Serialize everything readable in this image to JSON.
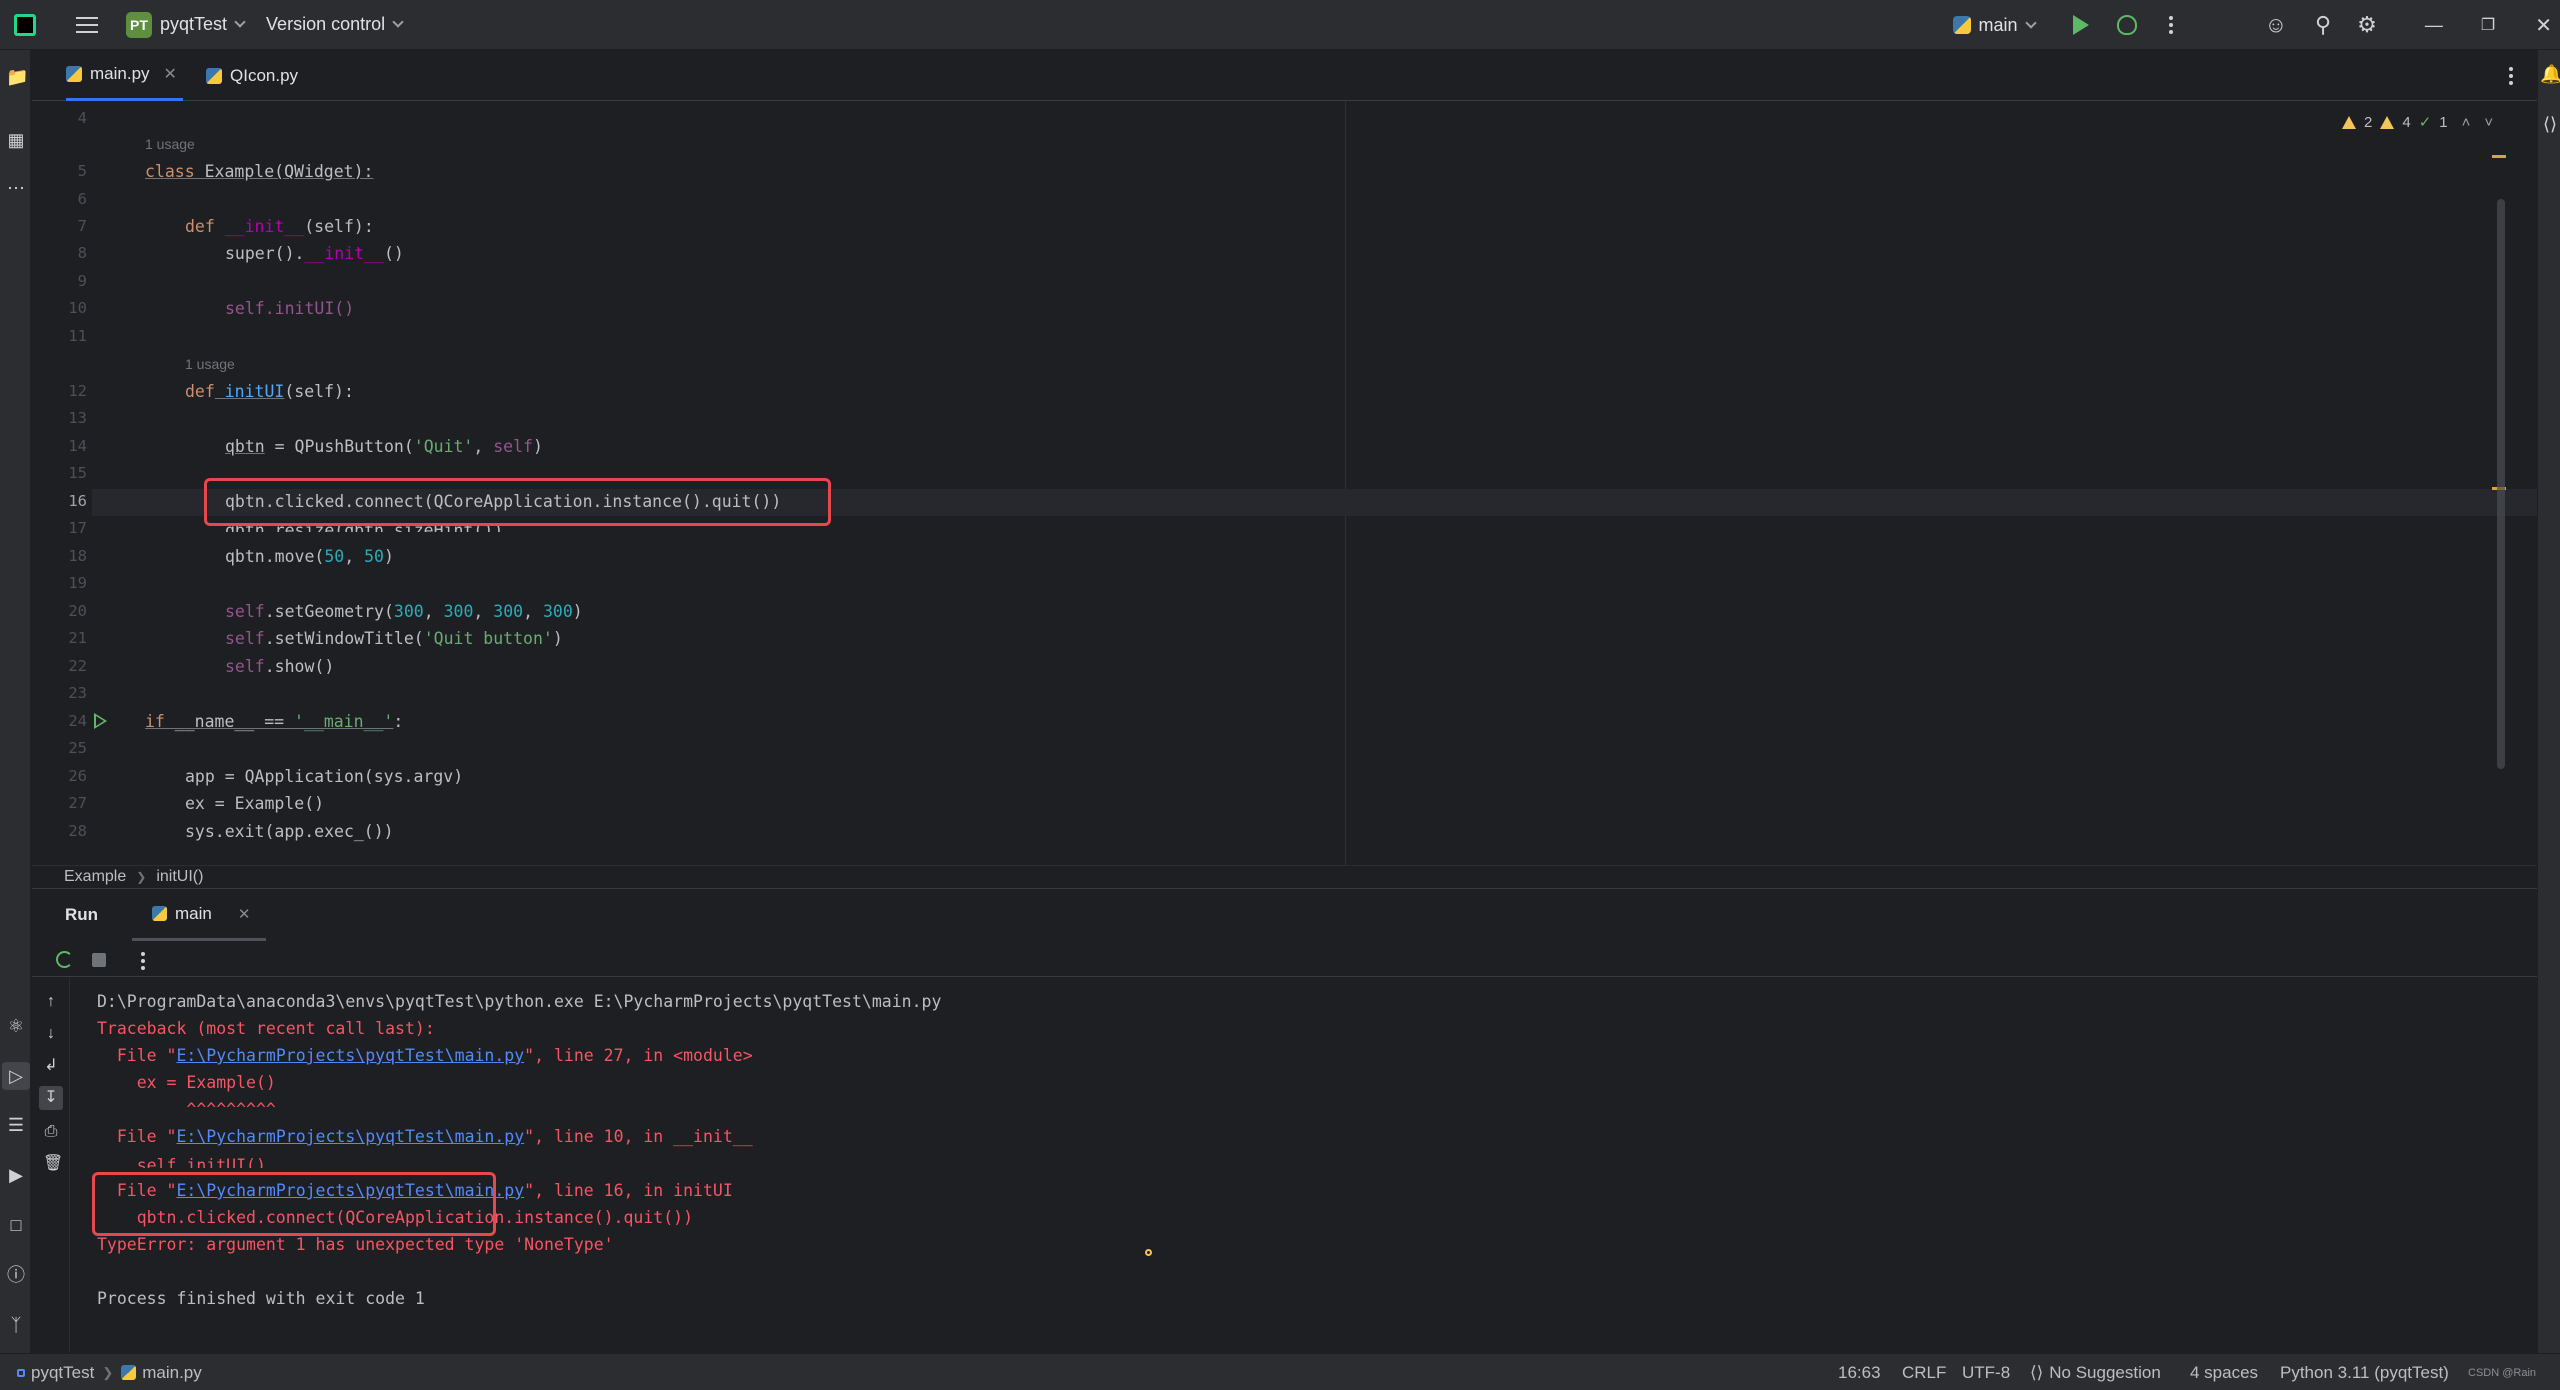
{
  "titlebar": {
    "project_badge": "PT",
    "project_name": "pyqtTest",
    "vcs_menu": "Version control",
    "run_config": "main"
  },
  "tabs": [
    {
      "label": "main.py",
      "active": true
    },
    {
      "label": "QIcon.py",
      "active": false
    }
  ],
  "inspections": {
    "warnings_a": "2",
    "warnings_b": "4",
    "ok": "1"
  },
  "editor": {
    "usage_hint": "1 usage",
    "current_line": 16,
    "lines": [
      {
        "n": "4"
      },
      {
        "n": "5"
      },
      {
        "n": "6"
      },
      {
        "n": "7"
      },
      {
        "n": "8"
      },
      {
        "n": "9"
      },
      {
        "n": "10"
      },
      {
        "n": "11"
      },
      {
        "n": "12"
      },
      {
        "n": "13"
      },
      {
        "n": "14"
      },
      {
        "n": "15"
      },
      {
        "n": "16"
      },
      {
        "n": "17"
      },
      {
        "n": "18"
      },
      {
        "n": "19"
      },
      {
        "n": "20"
      },
      {
        "n": "21"
      },
      {
        "n": "22"
      },
      {
        "n": "23"
      },
      {
        "n": "24"
      },
      {
        "n": "25"
      },
      {
        "n": "26"
      },
      {
        "n": "27"
      },
      {
        "n": "28"
      }
    ],
    "code": {
      "l5_kw": "class",
      "l5_rest": " Example(QWidget):",
      "l7_kw": "def",
      "l7_fn": " __init__",
      "l7_rest": "(self):",
      "l8_a": "super().",
      "l8_b": "__init__",
      "l8_c": "()",
      "l10": "self.initUI()",
      "l12_kw": "def",
      "l12_fn": " initUI",
      "l12_rest": "(self):",
      "l14_a": "qbtn",
      "l14_b": " = QPushButton(",
      "l14_c": "'Quit'",
      "l14_d": ", ",
      "l14_e": "self",
      "l14_f": ")",
      "l16": "qbtn.clicked.connect(QCoreApplication.instance().quit())",
      "l17": "qbtn.resize(qbtn.sizeHint())",
      "l18_a": "qbtn.move(",
      "l18_b": "50",
      "l18_c": ", ",
      "l18_d": "50",
      "l18_e": ")",
      "l20_a": "self",
      "l20_b": ".setGeometry(",
      "l20_c": "300",
      "l20_d": ", ",
      "l20_e": "300",
      "l20_f": ", ",
      "l20_g": "300",
      "l20_h": ", ",
      "l20_i": "300",
      "l20_j": ")",
      "l21_a": "self",
      "l21_b": ".setWindowTitle(",
      "l21_c": "'Quit button'",
      "l21_d": ")",
      "l22_a": "self",
      "l22_b": ".show()",
      "l24_kw": "if",
      "l24_a": " __name__ == ",
      "l24_b": "'__main__'",
      "l24_c": ":",
      "l26": "app = QApplication(sys.argv)",
      "l27": "ex = Example()",
      "l28": "sys.exit(app.exec_())"
    }
  },
  "breadcrumb": [
    "Example",
    "initUI()"
  ],
  "run_panel": {
    "title": "Run",
    "tab": "main",
    "console": {
      "cmd": "D:\\ProgramData\\anaconda3\\envs\\pyqtTest\\python.exe E:\\PycharmProjects\\pyqtTest\\main.py",
      "traceback": "Traceback (most recent call last):",
      "file_prefix": "  File \"",
      "file_link": "E:\\PycharmProjects\\pyqtTest\\main.py",
      "f1_suffix": "\", line 27, in <module>",
      "f1_code": "    ex = Example()",
      "f1_caret": "         ^^^^^^^^^",
      "f2_suffix": "\", line 10, in __init__",
      "f2_code": "    self.initUI()",
      "f3_suffix": "\", line 16, in initUI",
      "f3_code": "    qbtn.clicked.connect(QCoreApplication.instance().quit())",
      "error": "TypeError: argument 1 has unexpected type 'NoneType'",
      "exit": "Process finished with exit code 1"
    }
  },
  "statusbar": {
    "project": "pyqtTest",
    "file": "main.py",
    "position": "16:63",
    "line_sep": "CRLF",
    "encoding": "UTF-8",
    "suggestion": "No Suggestion",
    "indent": "4 spaces",
    "interpreter": "Python 3.11 (pyqtTest)",
    "watermark": "CSDN @Rain"
  },
  "colors": {
    "accent": "#3574f0",
    "error": "#f75464",
    "highlight_box": "#e5484d",
    "run_green": "#5fb865"
  }
}
